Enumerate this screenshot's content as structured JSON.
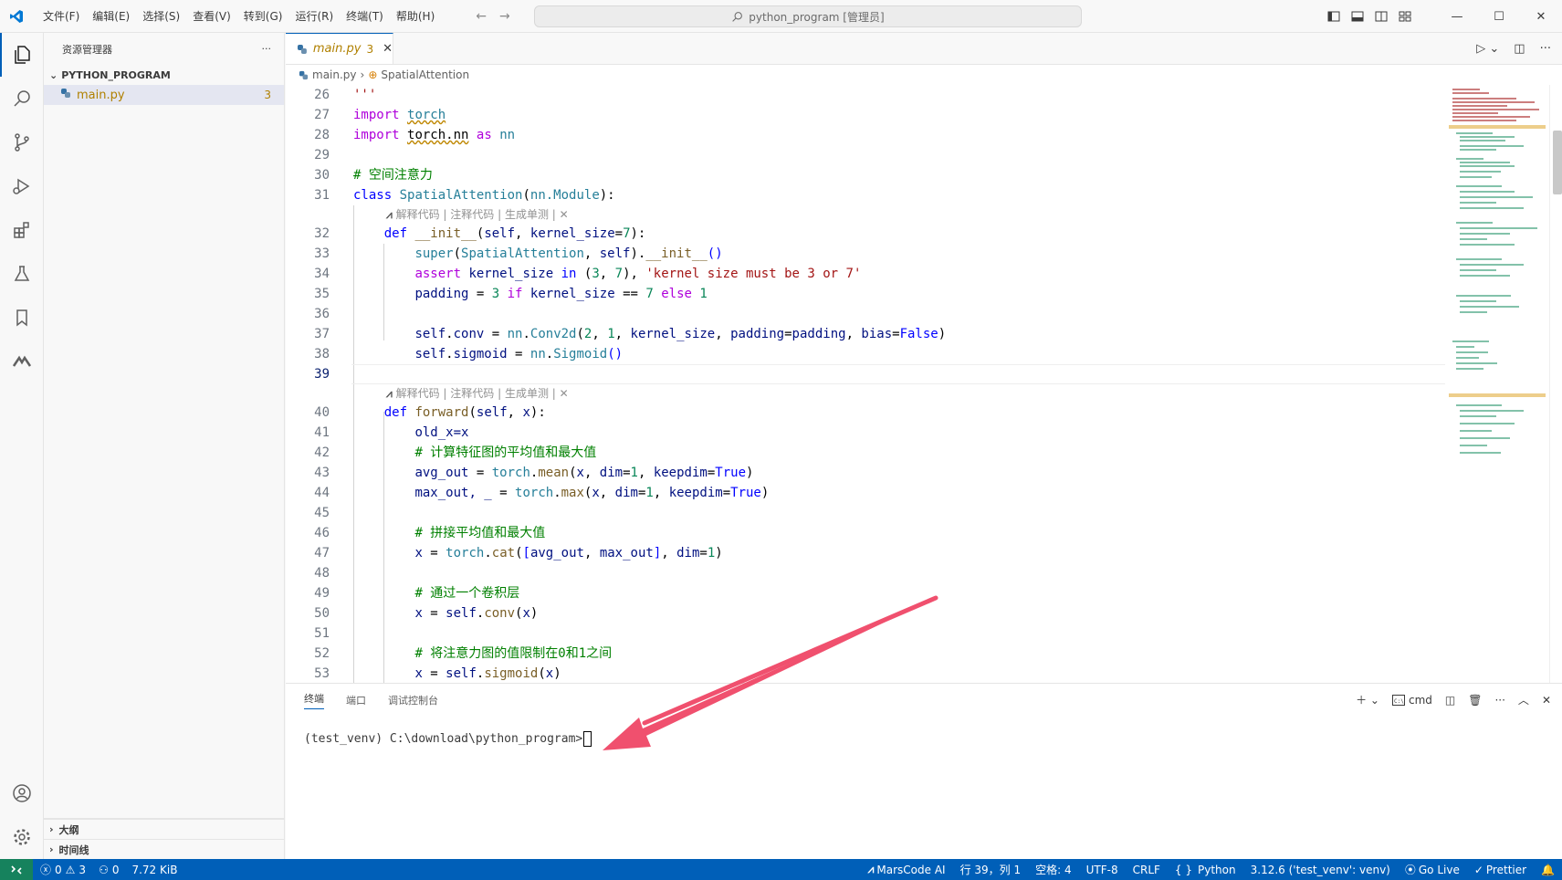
{
  "titlebar": {
    "menu": [
      "文件(F)",
      "编辑(E)",
      "选择(S)",
      "查看(V)",
      "转到(G)",
      "运行(R)",
      "终端(T)",
      "帮助(H)"
    ],
    "search_text": "python_program [管理员]"
  },
  "sidebar": {
    "title": "资源管理器",
    "project": "PYTHON_PROGRAM",
    "file": {
      "name": "main.py",
      "problems": "3"
    },
    "outline": "大纲",
    "timeline": "时间线"
  },
  "editor": {
    "tab": {
      "name": "main.py",
      "problems": "3"
    },
    "breadcrumb": {
      "file": "main.py",
      "symbol": "SpatialAttention"
    },
    "codelens": "解释代码 | 注释代码 | 生成单测 | ✕",
    "line_numbers": {
      "l26": "26",
      "l27": "27",
      "l28": "28",
      "l29": "29",
      "l30": "30",
      "l31": "31",
      "l32": "32",
      "l33": "33",
      "l34": "34",
      "l35": "35",
      "l36": "36",
      "l37": "37",
      "l38": "38",
      "l39": "39",
      "l40": "40",
      "l41": "41",
      "l42": "42",
      "l43": "43",
      "l44": "44",
      "l45": "45",
      "l46": "46",
      "l47": "47",
      "l48": "48",
      "l49": "49",
      "l50": "50",
      "l51": "51",
      "l52": "52",
      "l53": "53"
    },
    "code": {
      "l26": "'''",
      "l27_kw": "import",
      "l27_mod": "torch",
      "l28_kw": "import",
      "l28_mod": "torch.nn",
      "l28_as": "as",
      "l28_alias": "nn",
      "l30": "# 空间注意力",
      "l31_kw": "class",
      "l31_name": "SpatialAttention",
      "l31_base": "nn.Module",
      "l32_kw": "def",
      "l32_fn": "__init__",
      "l32_self": "self",
      "l32_arg": "kernel_size",
      "l32_num": "7",
      "l33_fn": "super",
      "l33_cls": "SpatialAttention",
      "l33_self": "self",
      "l33_init": "__init__",
      "l34_kw": "assert",
      "l34_var": "kernel_size",
      "l34_in": "in",
      "l34_n1": "3",
      "l34_n2": "7",
      "l34_str": "'kernel size must be 3 or 7'",
      "l35_var": "padding",
      "l35_n1": "3",
      "l35_if": "if",
      "l35_ks": "kernel_size",
      "l35_n2": "7",
      "l35_else": "else",
      "l35_n3": "1",
      "l37_self": "self",
      "l37_conv": "conv",
      "l37_nn": "nn",
      "l37_cls": "Conv2d",
      "l37_n1": "2",
      "l37_n2": "1",
      "l37_ks": "kernel_size",
      "l37_pad": "padding",
      "l37_padv": "padding",
      "l37_bias": "bias",
      "l37_false": "False",
      "l38_self": "self",
      "l38_sig": "sigmoid",
      "l38_nn": "nn",
      "l38_cls": "Sigmoid",
      "l40_kw": "def",
      "l40_fn": "forward",
      "l40_self": "self",
      "l40_x": "x",
      "l41": "old_x=x",
      "l42": "# 计算特征图的平均值和最大值",
      "l43_var": "avg_out",
      "l43_mod": "torch",
      "l43_fn": "mean",
      "l43_x": "x",
      "l43_dim": "dim",
      "l43_n": "1",
      "l43_kd": "keepdim",
      "l43_true": "True",
      "l44_var": "max_out, _",
      "l44_mod": "torch",
      "l44_fn": "max",
      "l44_x": "x",
      "l44_dim": "dim",
      "l44_n": "1",
      "l44_kd": "keepdim",
      "l44_true": "True",
      "l46": "# 拼接平均值和最大值",
      "l47_x": "x",
      "l47_mod": "torch",
      "l47_fn": "cat",
      "l47_a": "avg_out",
      "l47_b": "max_out",
      "l47_dim": "dim",
      "l47_n": "1",
      "l49": "# 通过一个卷积层",
      "l50_x": "x",
      "l50_self": "self",
      "l50_fn": "conv",
      "l50_arg": "x",
      "l52": "# 将注意力图的值限制在0和1之间",
      "l53_x": "x",
      "l53_self": "self",
      "l53_fn": "sigmoid",
      "l53_arg": "x"
    }
  },
  "panel": {
    "tabs": [
      "终端",
      "端口",
      "调试控制台"
    ],
    "shell": "cmd",
    "prompt": "(test_venv) C:\\download\\python_program>"
  },
  "statusbar": {
    "errors": "0",
    "warnings": "3",
    "ports": "0",
    "filesize": "7.72 KiB",
    "marscode": "MarsCode AI",
    "position": "行 39，列 1",
    "spaces": "空格: 4",
    "encoding": "UTF-8",
    "eol": "CRLF",
    "language": "Python",
    "interpreter": "3.12.6 ('test_venv': venv)",
    "golive": "Go Live",
    "prettier": "Prettier"
  },
  "colors": {
    "accent": "#005fb8",
    "arrow": "#f0506e",
    "warning": "#b08000"
  }
}
